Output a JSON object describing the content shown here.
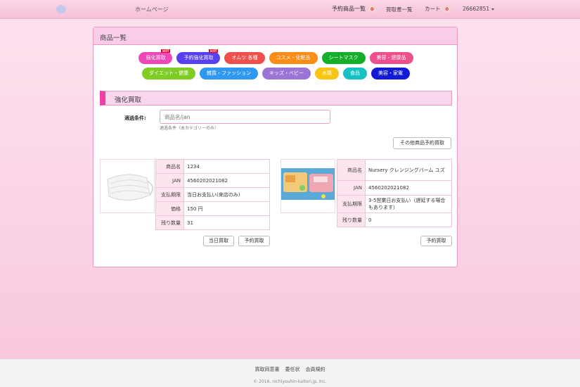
{
  "nav": {
    "home": "ホームページ",
    "reserve_list": "予約商品一覧",
    "reserve_count": "0",
    "buy_docs": "買取書一覧",
    "cart": "カート",
    "cart_count": "0",
    "user": "26662851"
  },
  "panel": {
    "title": "商品一覧"
  },
  "categories": {
    "row1": [
      {
        "label": "強化買取",
        "color": "#ef47b7",
        "hot": "HOT"
      },
      {
        "label": "予約強化買取",
        "color": "#5740f0",
        "hot": "HOT"
      },
      {
        "label": "オムツ 各種",
        "color": "#f0504c"
      },
      {
        "label": "コスメ・化粧品",
        "color": "#fb8c15"
      },
      {
        "label": "シートマスク",
        "color": "#15ae2a"
      },
      {
        "label": "美容・健康品",
        "color": "#ee4f8d"
      }
    ],
    "row2": [
      {
        "label": "ダイエット・健康",
        "color": "#7fcc24"
      },
      {
        "label": "雑貨・ファッション",
        "color": "#2f98f0"
      },
      {
        "label": "キッズ・ベビー",
        "color": "#9b75d6"
      },
      {
        "label": "水筒",
        "color": "#f8c515"
      },
      {
        "label": "食品",
        "color": "#19c0c2"
      },
      {
        "label": "美容・家電",
        "color": "#121ad4"
      }
    ]
  },
  "section": {
    "title": "強化買取"
  },
  "filter": {
    "label": "適過条件:",
    "placeholder": "商品名/jan",
    "help": "適過条件（本カテゴリーのみ）"
  },
  "other_reserve_button": "その他商品予約買取",
  "products": [
    {
      "rows": [
        {
          "k": "商品名",
          "v": "1234"
        },
        {
          "k": "JAN",
          "v": "4560202021082"
        },
        {
          "k": "支払期限",
          "v": "当日お支払い(来店のみ)"
        },
        {
          "k": "価格",
          "v": "150 円"
        },
        {
          "k": "残り数量",
          "v": "31"
        }
      ],
      "buttons": [
        "当日買取",
        "予約買取"
      ]
    },
    {
      "rows": [
        {
          "k": "商品名",
          "v": "Nursery クレンジングバーム ユズ"
        },
        {
          "k": "JAN",
          "v": "4560202021082"
        },
        {
          "k": "支払期限",
          "v": "3-5営業日お支払い（遅延する場合もあります）"
        },
        {
          "k": "残り数量",
          "v": "0"
        }
      ],
      "buttons": [
        "予約買取"
      ]
    }
  ],
  "footer": {
    "links": [
      "買取同意書",
      "委任状",
      "会員規約"
    ],
    "copyright": "© 2016, nichiyouhin-kaitori.jp, Inc."
  }
}
